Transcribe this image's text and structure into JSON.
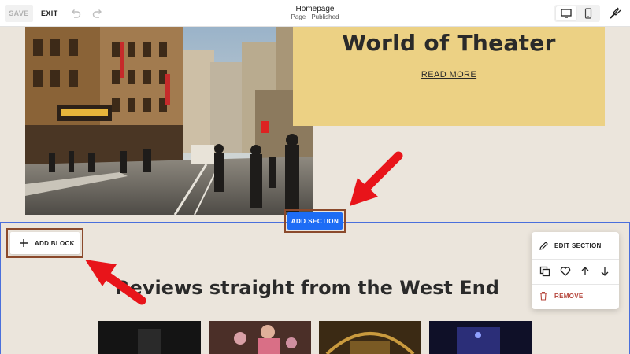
{
  "toolbar": {
    "save_label": "SAVE",
    "exit_label": "EXIT",
    "page_title": "Homepage",
    "page_status": "Page · Published",
    "icons": [
      "undo-icon",
      "redo-icon",
      "desktop-icon",
      "mobile-icon",
      "paintbrush-icon"
    ]
  },
  "hero": {
    "title": "World of Theater",
    "link_label": "READ MORE"
  },
  "add_section_label": "ADD SECTION",
  "section": {
    "add_block_label": "ADD BLOCK",
    "heading": "Reviews straight from the West End",
    "menu": {
      "edit_label": "EDIT SECTION",
      "icons": [
        "duplicate-icon",
        "heart-icon",
        "arrow-up-icon",
        "arrow-down-icon"
      ],
      "remove_label": "REMOVE"
    }
  },
  "colors": {
    "accent": "#1d6cf5",
    "hero_card": "#ecd184",
    "background": "#ebe5dc",
    "annotation": "#e8141a",
    "remove": "#b5453b"
  }
}
